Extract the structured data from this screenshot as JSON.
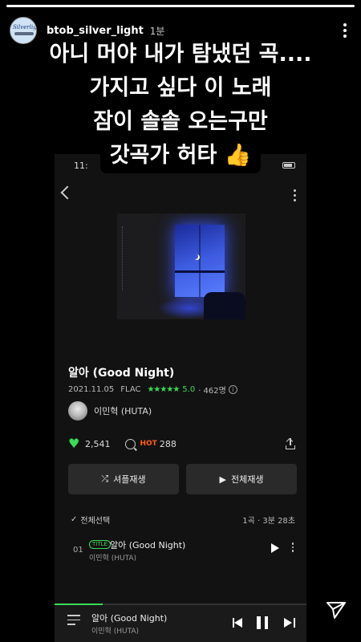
{
  "story": {
    "username": "btob_silver_light",
    "time_ago": "1분",
    "avatar_text": "Silverlight",
    "progress": 1.0
  },
  "caption": {
    "lines": [
      "아니 머야 내가 탐냈던 곡....",
      "가지고 싶다 이 노래",
      "잠이 솔솔 오는구만",
      "갓곡가 허타 👍"
    ]
  },
  "screen": {
    "status_time": "11:",
    "song": {
      "title": "알아 (Good Night)",
      "date": "2021.11.05",
      "format": "FLAC",
      "stars": "★★★★★",
      "rating": "5.0",
      "reviews": "· 462명",
      "artist": "이민혁 (HUTA)"
    },
    "stats": {
      "likes": "2,541",
      "hot_label": "HOT",
      "comments": "288"
    },
    "buttons": {
      "shuffle": "셔플재생",
      "play_all": "전체재생"
    },
    "tracklist": {
      "select_all": "전체선택",
      "summary": "1곡 · 3분 28초",
      "tracks": [
        {
          "num": "01",
          "badge": "TITLE",
          "title": "알아 (Good Night)",
          "artist": "이민혁 (HUTA)"
        }
      ]
    },
    "mini_player": {
      "title": "알아 (Good Night)",
      "artist": "이민혁 (HUTA)",
      "progress": 0.19
    }
  },
  "colors": {
    "accent_green": "#3adb56",
    "hot_orange": "#ff5e1e"
  },
  "icons": [
    "more-vert-icon",
    "back-chevron-icon",
    "info-icon",
    "heart-icon",
    "comment-icon",
    "share-icon",
    "shuffle-icon",
    "play-icon",
    "check-icon",
    "list-icon",
    "prev-icon",
    "pause-icon",
    "next-icon",
    "send-icon"
  ]
}
